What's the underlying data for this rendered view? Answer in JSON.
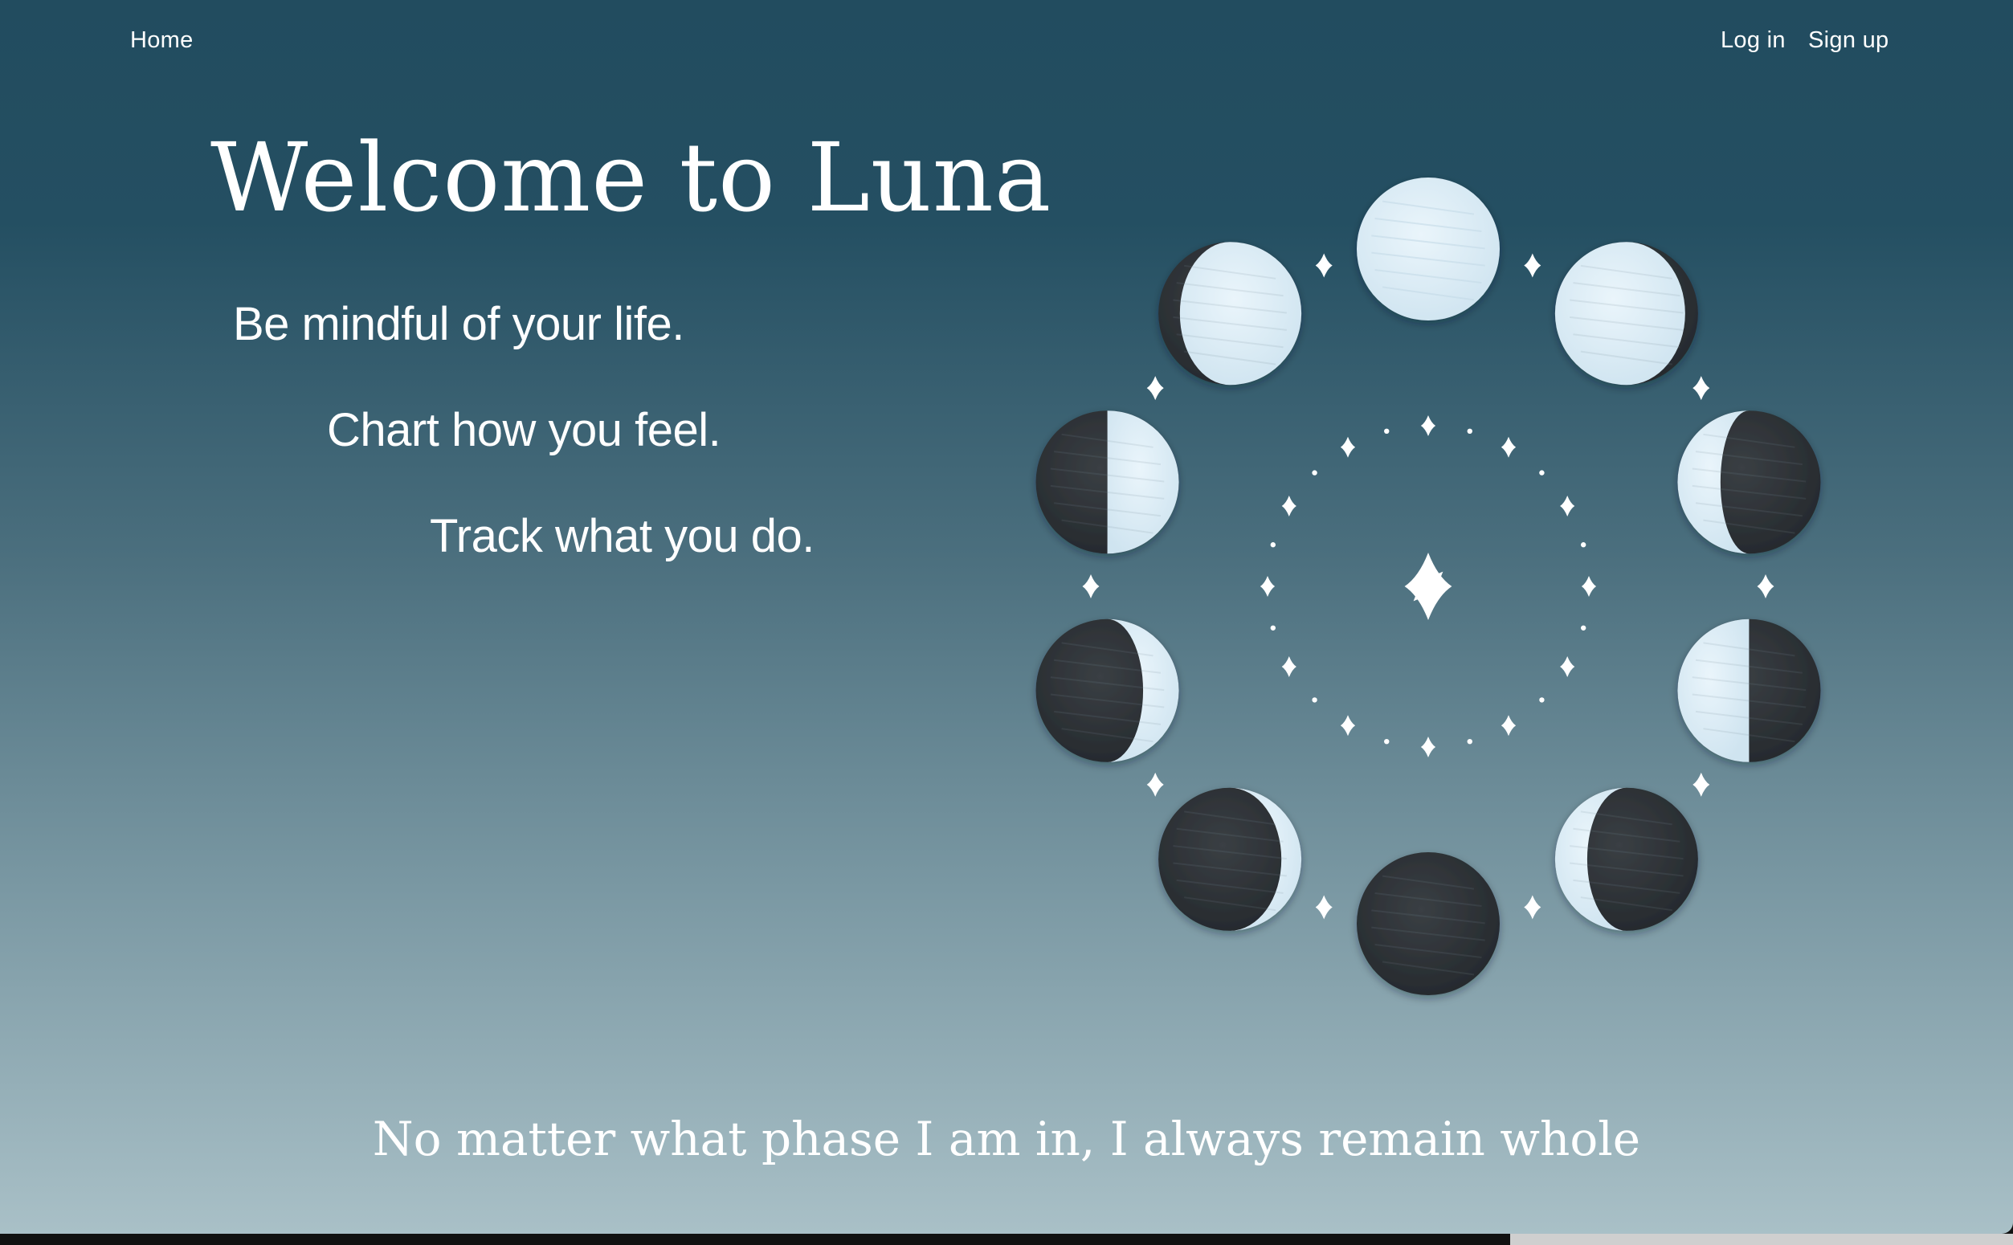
{
  "nav": {
    "home": "Home",
    "login": "Log in",
    "signup": "Sign up"
  },
  "hero": {
    "title": "Welcome to Luna",
    "taglines": [
      "Be mindful of your life.",
      "Chart how you feel.",
      "Track what you do."
    ]
  },
  "footer": {
    "quote": "No matter what phase I am in, I always remain whole"
  },
  "illustration": {
    "moon_phases": [
      "full-moon",
      "waning-gibbous",
      "last-quarter",
      "waning-crescent",
      "new-moon",
      "waxing-crescent",
      "waxing-crescent",
      "first-quarter",
      "waxing-gibbous"
    ],
    "center_icon": "sparkle-star-icon",
    "colors": {
      "moon_light": "#ddeef8",
      "moon_dark": "#2b3035",
      "star": "#ffffff"
    }
  }
}
